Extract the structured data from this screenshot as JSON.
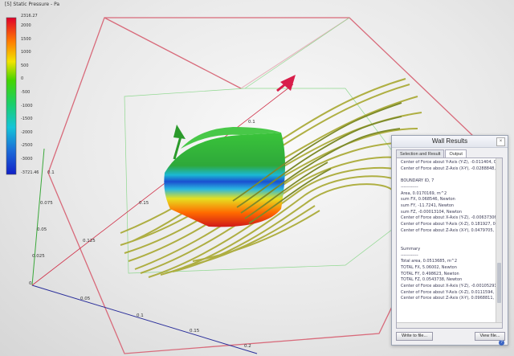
{
  "legend": {
    "title": "[5] Static Pressure - Pa",
    "max": "2316.27",
    "min": "-3721.46",
    "ticks": [
      "2000",
      "1500",
      "1000",
      "500",
      "0",
      "-500",
      "-1000",
      "-1500",
      "-2000",
      "-2500",
      "-3000"
    ]
  },
  "axes": {
    "y_ticks": [
      "0.1",
      "0.075",
      "0.05",
      "0.025",
      "0"
    ],
    "x_ticks": [
      "0.05",
      "0.1",
      "0.15",
      "0.2"
    ],
    "z_ticks": [
      "0.125",
      "0.15",
      "0.1"
    ]
  },
  "panel": {
    "title": "Wall Results",
    "close": "×",
    "tabs": [
      "Selection and Result",
      "Output"
    ],
    "lines": [
      "Center of Force about Y-Axis (Y-Z), -0.011404, 0",
      "Center of Force about Z-Axis (X-Y), -0.0288848,",
      "",
      "BOUNDARY ID, 7",
      "------------",
      "Area, 0.0170169, m^2",
      "sum FX, 0.068546, Newton",
      "sum FY, -11.7241, Newton",
      "sum FZ, -0.00013104, Newton",
      "Center of Force about X-Axis (Y-Z), -0.00637306",
      "Center of Force about Y-Axis (X-Z), 0.181927, 0.",
      "Center of Force about Z-Axis (X-Y), 0.0479705, 0",
      "",
      "",
      "Summary",
      "------------",
      "Total area, 0.0513685, m^2",
      "TOTAL FX, 5.06002, Newton",
      "TOTAL FY, 0.498623, Newton",
      "TOTAL FZ, 0.0543738, Newton",
      "Center of Force about X-Axis (Y-Z), -0.00105291,",
      "Center of Force about Y-Axis (X-Z), 0.0111594, 0",
      "Center of Force about Z-Axis (X-Y), 0.0968811, 0"
    ],
    "write_btn": "Write to file...",
    "view_btn": "View file...",
    "help": "?"
  },
  "colors": {
    "domain_box": "#d86a7a",
    "x_axis": "#d03048",
    "y_axis": "#3aa83a",
    "z_axis": "#2a2e9a",
    "panel_border": "#9aa3b3"
  }
}
